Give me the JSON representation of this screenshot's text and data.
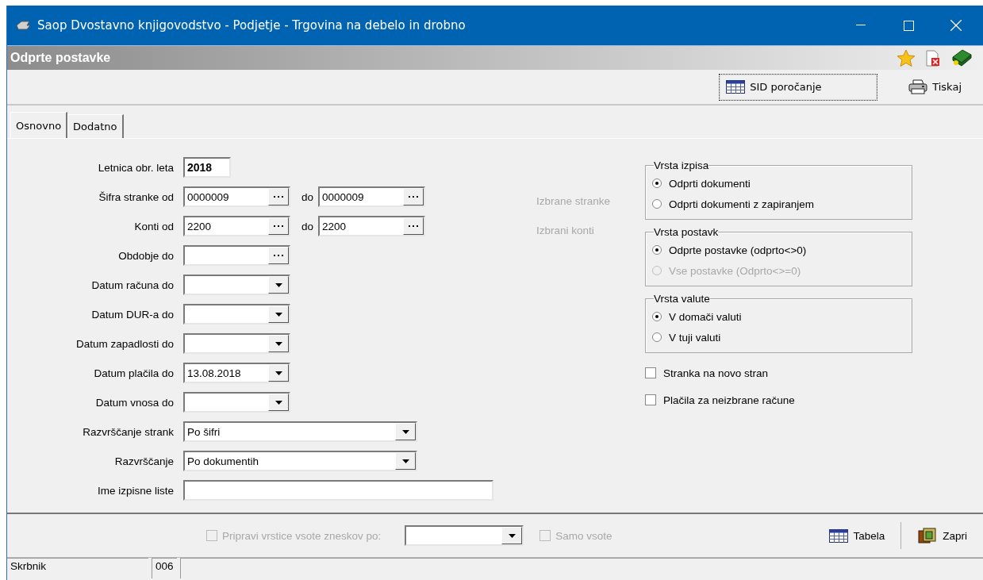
{
  "window": {
    "title": "Saop Dvostavno knjigovodstvo - Podjetje - Trgovina na debelo in drobno"
  },
  "panel": {
    "title": "Odprte postavke"
  },
  "toolbar": {
    "buttons": [
      {
        "label": "SID poročanje",
        "kind": "table",
        "focused": true
      },
      {
        "label": "Tiskaj",
        "kind": "printer",
        "focused": false
      }
    ]
  },
  "tabs": [
    {
      "label": "Osnovno",
      "selected": true
    },
    {
      "label": "Dodatno",
      "selected": false
    }
  ],
  "fields": [
    {
      "label": "Letnica obr. leta",
      "kind": "year",
      "value": "2018"
    },
    {
      "label": "Šifra stranke od",
      "kind": "lookup",
      "value": "0000009",
      "range_label": "do",
      "to_value": "0000009"
    },
    {
      "label": "Konti od",
      "kind": "lookup",
      "value": "2200",
      "range_label": "do",
      "to_value": "2200"
    },
    {
      "label": "Obdobje do",
      "kind": "lookup"
    },
    {
      "label": "Datum računa do",
      "kind": "date"
    },
    {
      "label": "Datum DUR-a do",
      "kind": "date"
    },
    {
      "label": "Datum zapadlosti do",
      "kind": "date"
    },
    {
      "label": "Datum plačila do",
      "kind": "date",
      "value": "13.08.2018"
    },
    {
      "label": "Datum vnosa do",
      "kind": "date"
    },
    {
      "label": "Razvrščanje strank",
      "kind": "combo",
      "value": "Po šifri"
    },
    {
      "label": "Razvrščanje",
      "kind": "combo",
      "value": "Po dokumentih"
    },
    {
      "label": "Ime izpisne liste",
      "kind": "text"
    }
  ],
  "selection_labels": [
    {
      "label": "Izbrane stranke",
      "disabled": true
    },
    {
      "label": "Izbrani konti",
      "disabled": true
    }
  ],
  "groups": [
    {
      "title": "Vrsta izpisa",
      "options": [
        {
          "label": "Odprti dokumenti",
          "selected": true,
          "disabled": false
        },
        {
          "label": "Odprti dokumenti z zapiranjem",
          "selected": false,
          "disabled": false
        }
      ]
    },
    {
      "title": "Vrsta postavk",
      "options": [
        {
          "label": "Odprte postavke (odprto<>0)",
          "selected": true,
          "disabled": false
        },
        {
          "label": "Vse postavke (Odprto<>=0)",
          "selected": false,
          "disabled": true
        }
      ]
    },
    {
      "title": "Vrsta valute",
      "options": [
        {
          "label": "V domači valuti",
          "selected": true,
          "disabled": false
        },
        {
          "label": "V tuji valuti",
          "selected": false,
          "disabled": false
        }
      ]
    }
  ],
  "checkboxes": [
    {
      "label": "Stranka na novo stran",
      "checked": false
    },
    {
      "label": "Plačila za neizbrane račune",
      "checked": false
    }
  ],
  "footer": {
    "sum_rows": {
      "label": "Pripravi vrstice vsote zneskov po:",
      "checked": false,
      "disabled": true
    },
    "only_sums": {
      "label": "Samo vsote",
      "checked": false,
      "disabled": true
    },
    "buttons": [
      {
        "label": "Tabela",
        "kind": "table"
      },
      {
        "label": "Zapri",
        "kind": "close"
      }
    ]
  },
  "status_bar": {
    "cells": [
      "Skrbnik",
      "006"
    ]
  }
}
